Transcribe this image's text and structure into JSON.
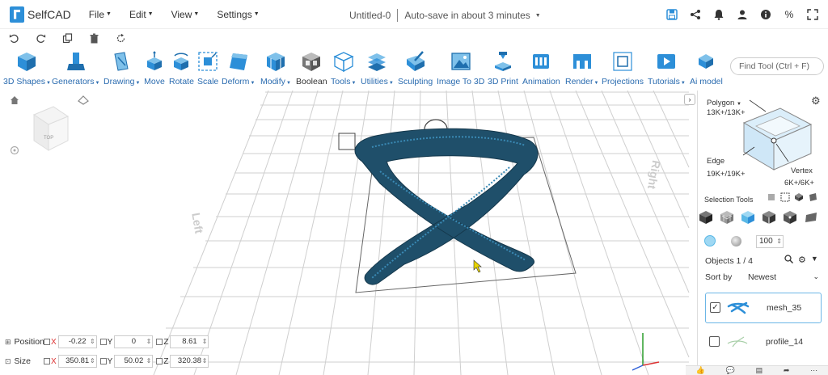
{
  "app": {
    "name": "SelfCAD"
  },
  "menu": [
    {
      "label": "File"
    },
    {
      "label": "Edit"
    },
    {
      "label": "View"
    },
    {
      "label": "Settings"
    }
  ],
  "document": {
    "title": "Untitled-0",
    "autosave": "Auto-save in about 3 minutes"
  },
  "top_icons": [
    "save-icon",
    "share-icon",
    "bell-icon",
    "user-icon",
    "info-icon",
    "percent-icon"
  ],
  "quick_icons": [
    "undo-icon",
    "redo-icon",
    "copy-icon",
    "delete-icon",
    "refresh-icon"
  ],
  "toolbar": [
    {
      "label": "3D Shapes",
      "dropdown": true
    },
    {
      "label": "Generators",
      "dropdown": true
    },
    {
      "label": "Drawing",
      "dropdown": true
    },
    {
      "label": "Move"
    },
    {
      "label": "Rotate"
    },
    {
      "label": "Scale"
    },
    {
      "label": "Deform",
      "dropdown": true
    },
    {
      "label": "Modify",
      "dropdown": true
    },
    {
      "label": "Boolean"
    },
    {
      "label": "Tools",
      "dropdown": true
    },
    {
      "label": "Utilities",
      "dropdown": true
    },
    {
      "label": "Sculpting"
    },
    {
      "label": "Image To 3D"
    },
    {
      "label": "3D Print"
    },
    {
      "label": "Animation"
    },
    {
      "label": "Render",
      "dropdown": true
    },
    {
      "label": "Projections"
    },
    {
      "label": "Tutorials",
      "dropdown": true
    },
    {
      "label": "Ai model"
    }
  ],
  "find_tool": {
    "placeholder": "Find Tool (Ctrl + F)"
  },
  "viewport": {
    "label_left": "Left",
    "label_right": "Right",
    "view_cube_label": "TOP"
  },
  "transform": {
    "position_label": "Position",
    "size_label": "Size",
    "position": {
      "x": "-0.22",
      "y": "0",
      "z": "8.61"
    },
    "size": {
      "x": "350.81",
      "y": "50.02",
      "z": "320.38"
    }
  },
  "selection_panel": {
    "polygon_label": "Polygon",
    "polygon_count": "13K+/13K+",
    "edge_label": "Edge",
    "edge_count": "19K+/19K+",
    "vertex_label": "Vertex",
    "vertex_count": "6K+/6K+",
    "selection_tools_label": "Selection Tools",
    "size_value": "100"
  },
  "objects": {
    "header": "Objects 1 / 4",
    "sort_label": "Sort by",
    "sort_value": "Newest",
    "items": [
      {
        "name": "mesh_35",
        "checked": true
      },
      {
        "name": "profile_14",
        "checked": false
      }
    ]
  },
  "colors": {
    "accent": "#2d8fd8",
    "mesh": "#1f4f6a",
    "mesh_highlight": "#3a8ab5",
    "grid": "#cfcfcf"
  }
}
